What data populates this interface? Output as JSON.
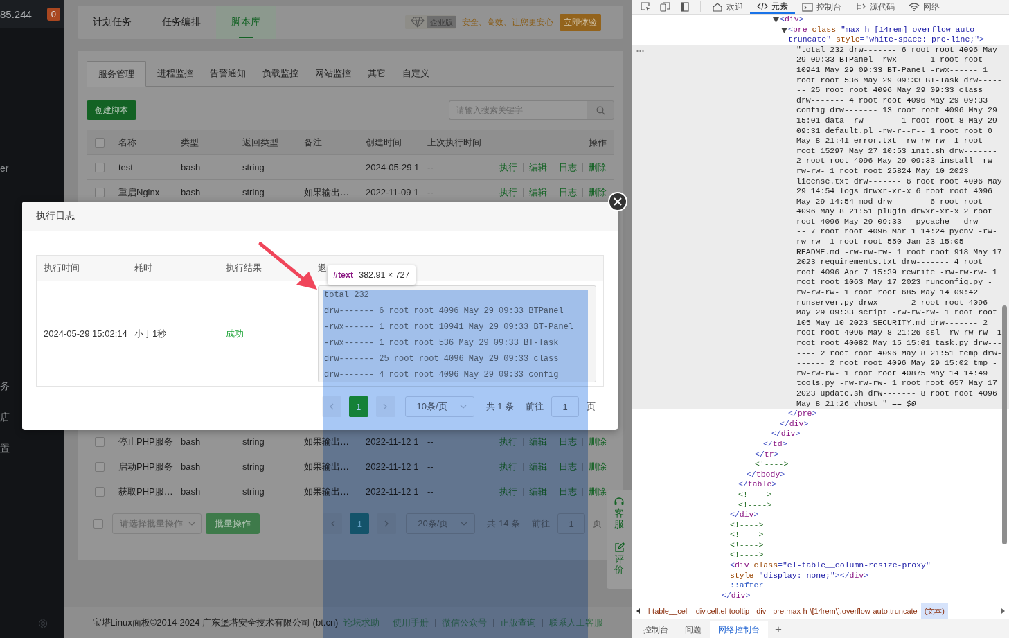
{
  "sidebar": {
    "host": "85.244",
    "badge": "0",
    "items": [
      {
        "label": "er"
      },
      {
        "label": "务"
      },
      {
        "label": "店"
      },
      {
        "label": "置"
      }
    ]
  },
  "top_tabs": [
    {
      "label": "计划任务",
      "selected": false
    },
    {
      "label": "任务编排",
      "selected": false
    },
    {
      "label": "脚本库",
      "selected": true
    }
  ],
  "promo": {
    "badge": "企业版",
    "slogan": "安全、高效、让您更安心",
    "button": "立即体验"
  },
  "sub_tabs": [
    {
      "label": "服务管理",
      "selected": true
    },
    {
      "label": "进程监控",
      "selected": false
    },
    {
      "label": "告警通知",
      "selected": false
    },
    {
      "label": "负载监控",
      "selected": false
    },
    {
      "label": "网站监控",
      "selected": false
    },
    {
      "label": "其它",
      "selected": false
    },
    {
      "label": "自定义",
      "selected": false
    }
  ],
  "create_button": "创建脚本",
  "search": {
    "placeholder": "请输入搜索关键字"
  },
  "table": {
    "checked": false,
    "columns": [
      "名称",
      "类型",
      "返回类型",
      "备注",
      "创建时间",
      "上次执行时间",
      "操作"
    ],
    "rows": [
      {
        "checked": false,
        "name": "test",
        "type": "bash",
        "return_type": "string",
        "created": "2024-05-29 1",
        "last_run": "--",
        "actions": [
          "执行",
          "编辑",
          "日志",
          "删除"
        ]
      },
      {
        "checked": false,
        "name": "重启Nginx",
        "type": "bash",
        "return_type": "string",
        "note": "如果输出…",
        "created": "2022-11-09 1",
        "last_run": "--",
        "actions": [
          "执行",
          "编辑",
          "日志",
          "删除"
        ]
      }
    ],
    "more_rows": [
      {
        "checked": false,
        "name": "停止PHP服务",
        "type": "bash",
        "return_type": "string",
        "note": "如果输出…",
        "created": "2022-11-12 1",
        "last_run": "--",
        "actions": [
          "执行",
          "编辑",
          "日志",
          "删除"
        ]
      },
      {
        "checked": false,
        "name": "启动PHP服务",
        "type": "bash",
        "return_type": "string",
        "note": "如果输出…",
        "created": "2022-11-12 1",
        "last_run": "--",
        "actions": [
          "执行",
          "编辑",
          "日志",
          "删除"
        ]
      },
      {
        "checked": false,
        "name": "获取PHP服…",
        "type": "bash",
        "return_type": "string",
        "note": "如果输出…",
        "created": "2022-11-12 1",
        "last_run": "--",
        "actions": [
          "执行",
          "编辑",
          "日志",
          "删除"
        ]
      }
    ]
  },
  "batch": {
    "checked": false,
    "placeholder": "请选择批量操作",
    "button": "批量操作"
  },
  "pagination": {
    "pages": [
      {
        "label": "1",
        "selected": true
      }
    ],
    "page_size": "20条/页",
    "total": "共 14 条",
    "goto": "前往",
    "page_input": "1",
    "suffix": "页"
  },
  "footer": {
    "copyright": "宝塔Linux面板©2014-2024 广东堡塔安全技术有限公司 (bt.cn)",
    "links": [
      "论坛求助",
      "使用手册",
      "微信公众号",
      "正版查询",
      "联系人工客服"
    ]
  },
  "float_panel": [
    {
      "kind": "service",
      "label": "客服"
    },
    {
      "kind": "review",
      "label": "评价"
    }
  ],
  "modal": {
    "title": "执行日志",
    "columns": [
      "执行时间",
      "耗时",
      "执行结果",
      "返"
    ],
    "row": {
      "time": "2024-05-29 15:02:14",
      "duration": "小于1秒",
      "result": "成功",
      "output": [
        "total 232",
        "drw------- 6 root root 4096 May 29 09:33 BTPanel",
        "-rwx------ 1 root root 10941 May 29 09:33 BT-Panel",
        "-rwx------ 1 root root 536 May 29 09:33 BT-Task",
        "drw------- 25 root root 4096 May 29 09:33 class",
        "drw------- 4 root root 4096 May 29 09:33 config"
      ]
    },
    "pagination": {
      "pages": [
        {
          "label": "1",
          "selected": true
        }
      ],
      "page_size": "10条/页",
      "total": "共 1 条",
      "goto": "前往",
      "page_input": "1",
      "suffix": "页"
    }
  },
  "inspect_tooltip": {
    "node": "#text",
    "size": "382.91 × 727"
  },
  "devtools": {
    "tabs": [
      {
        "kind": "home",
        "label": "欢迎",
        "selected": false
      },
      {
        "kind": "elements",
        "label": "元素",
        "selected": true
      },
      {
        "kind": "console",
        "label": "控制台",
        "selected": false
      },
      {
        "kind": "sources",
        "label": "源代码",
        "selected": false
      },
      {
        "kind": "network",
        "label": "网络",
        "selected": false
      }
    ],
    "tree": {
      "kind": "element",
      "close": "</div>",
      "children": [
        {
          "kind": "element",
          "close": "</div>",
          "children": [
            {
              "kind": "element",
              "close": "</table>",
              "children": [
                {
                  "kind": "element",
                  "close": "</tbody>",
                  "children": [
                    {
                      "kind": "element",
                      "close": "</tr>",
                      "children": [
                        {
                          "kind": "element",
                          "close": "</td>",
                          "children": [
                            {
                              "kind": "element",
                              "close": "</div>",
                              "children": [
                                {
                                  "kind": "element",
                                  "open": "<div>",
                                  "expanded": true,
                                  "close": "</div>",
                                  "children": [
                                    {
                                      "kind": "element",
                                      "open": "<pre class=\"max-h-[14rem] overflow-auto truncate\" style=\"white-space: pre-line;\">",
                                      "expanded": true,
                                      "close": "</pre>",
                                      "children": [
                                        {
                                          "kind": "text",
                                          "selected": true,
                                          "text": "\"total 232 drw------- 6 root root 4096 May 29 09:33 BTPanel -rwx------ 1 root root 10941 May 29 09:33 BT-Panel -rwx------ 1 root root 536 May 29 09:33 BT-Task drw------- 25 root root 4096 May 29 09:33 class drw------- 4 root root 4096 May 29 09:33 config drw------- 13 root root 4096 May 29 15:01 data -rw------- 1 root root 8 May 29 09:31 default.pl -rw-r--r-- 1 root root 0 May 8 21:41 error.txt -rw-rw-rw- 1 root root 15297 May 27 10:53 init.sh drw------- 2 root root 4096 May 29 09:33 install -rw-rw-rw- 1 root root 25824 May 10 2023 license.txt drw------- 6 root root 4096 May 29 14:54 logs drwxr-xr-x 6 root root 4096 May 29 14:54 mod drw------- 6 root root 4096 May 8 21:51 plugin drwxr-xr-x 2 root root 4096 May 29 09:33 __pycache__ drw------- 7 root root 4096 Mar 1 14:24 pyenv -rw-rw-rw- 1 root root 550 Jan 23 15:05 README.md -rw-rw-rw- 1 root root 918 May 17 2023 requirements.txt drw------- 4 root root 4096 Apr 7 15:39 rewrite -rw-rw-rw- 1 root root 1063 May 17 2023 runconfig.py -rw-rw-rw- 1 root root 685 May 14 09:42 runserver.py drwx------ 2 root root 4096 May 29 09:33 script -rw-rw-rw- 1 root root 105 May 10 2023 SECURITY.md drw------- 2 root root 4096 May 8 21:26 ssl -rw-rw-rw- 1 root root 40082 May 15 15:01 task.py drw------- 2 root root 4096 May 8 21:51 temp drw------- 2 root root 4096 May 29 15:02 tmp -rw-rw-rw- 1 root root 40875 May 14 14:49 tools.py -rw-rw-rw- 1 root root 657 May 17 2023 update.sh drw------- 8 root root 4096 May 8 21:26 vhost \" *== $0*"
                                        }
                                      ]
                                    }
                                  ]
                                }
                              ]
                            }
                          ]
                        }
                      ]
                    },
                    {
                      "kind": "comment",
                      "text": "<!---->"
                    }
                  ]
                }
              ]
            },
            {
              "kind": "comment",
              "text": "<!---->"
            },
            {
              "kind": "comment",
              "text": "<!---->"
            }
          ]
        },
        {
          "kind": "comment",
          "text": "<!---->"
        },
        {
          "kind": "comment",
          "text": "<!---->"
        },
        {
          "kind": "comment",
          "text": "<!---->"
        },
        {
          "kind": "comment",
          "text": "<!---->"
        },
        {
          "kind": "element",
          "open": "<div class=\"el-table__column-resize-proxy\" style=\"display: none;\"></div>"
        },
        {
          "kind": "pseudo",
          "text": "::after"
        }
      ]
    },
    "breadcrumbs": [
      {
        "label": "l-table__cell",
        "selected": false
      },
      {
        "label": "div.cell.el-tooltip",
        "selected": false
      },
      {
        "label": "div",
        "selected": false
      },
      {
        "label": "pre.max-h-\\[14rem\\].overflow-auto.truncate",
        "selected": false
      },
      {
        "label": "(文本)",
        "selected": true
      }
    ],
    "drawer_tabs": [
      {
        "label": "控制台",
        "selected": false
      },
      {
        "label": "问题",
        "selected": false
      },
      {
        "label": "网络控制台",
        "selected": true
      }
    ],
    "add_tab": "+"
  }
}
